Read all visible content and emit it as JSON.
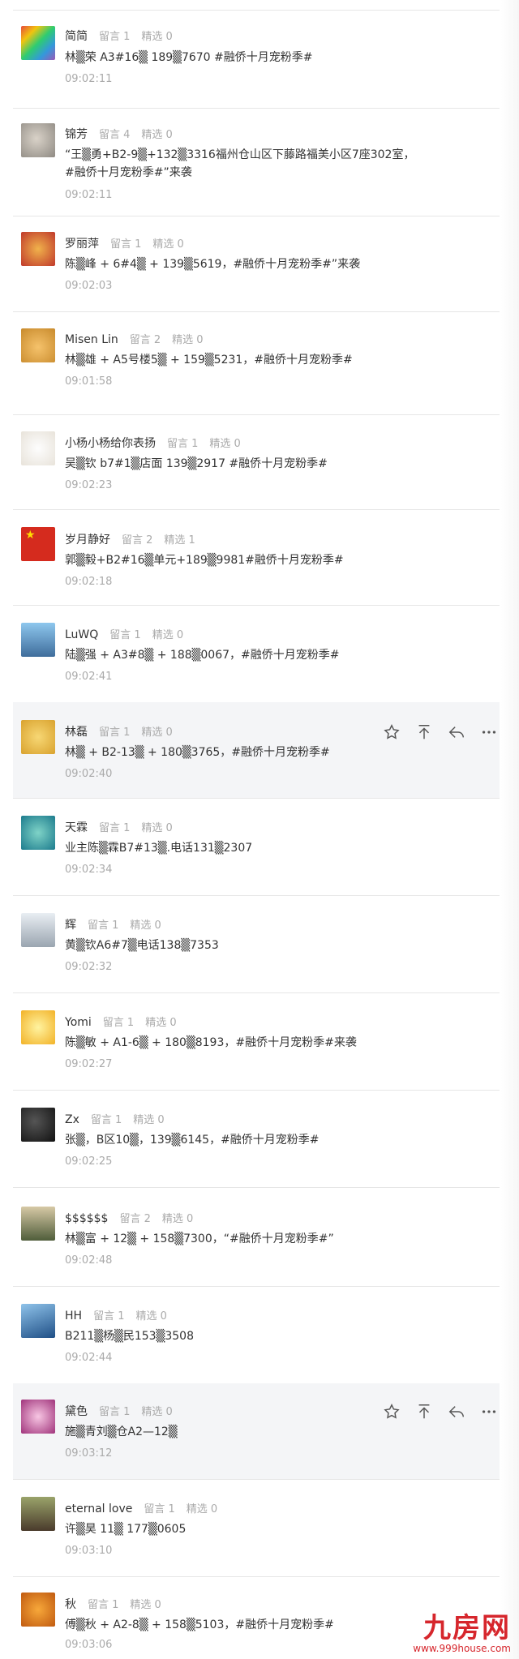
{
  "watermark": {
    "logo": "九房网",
    "url": "www.999house.com"
  },
  "comments": [
    {
      "nick": "简简",
      "msg": "留言 1",
      "sel": "精选 0",
      "content": "林▒荣 A3#16▒ 189▒7670 #融侨十月宠粉季#",
      "time": "09:02:11",
      "highlight": false
    },
    {
      "nick": "锦芳",
      "msg": "留言 4",
      "sel": "精选 0",
      "content": "“王▒勇+B2-9▒+132▒3316福州仓山区下藤路福美小区7座302室，#融侨十月宠粉季#”来袭",
      "time": "09:02:11",
      "highlight": false
    },
    {
      "nick": "罗丽萍",
      "msg": "留言 1",
      "sel": "精选 0",
      "content": "陈▒峰 + 6#4▒ + 139▒5619，#融侨十月宠粉季#”来袭",
      "time": "09:02:03",
      "highlight": false
    },
    {
      "nick": "Misen Lin",
      "msg": "留言 2",
      "sel": "精选 0",
      "content": "林▒雄 + A5号楼5▒ + 159▒5231，#融侨十月宠粉季#",
      "time": "09:01:58",
      "highlight": false
    },
    {
      "nick": "小杨小杨给你表扬",
      "msg": "留言 1",
      "sel": "精选 0",
      "content": "吴▒钦 b7#1▒店面 139▒2917 #融侨十月宠粉季#",
      "time": "09:02:23",
      "highlight": false
    },
    {
      "nick": "岁月静好",
      "msg": "留言 2",
      "sel": "精选 1",
      "content": "郭▒毅+B2#16▒单元+189▒9981#融侨十月宠粉季#",
      "time": "09:02:18",
      "highlight": false
    },
    {
      "nick": "LuWQ",
      "msg": "留言 1",
      "sel": "精选 0",
      "content": "陆▒强 + A3#8▒ + 188▒0067，#融侨十月宠粉季#",
      "time": "09:02:41",
      "highlight": false
    },
    {
      "nick": "林磊",
      "msg": "留言 1",
      "sel": "精选 0",
      "content": "林▒ + B2-13▒ + 180▒3765，#融侨十月宠粉季#",
      "time": "09:02:40",
      "highlight": true
    },
    {
      "nick": "天霖",
      "msg": "留言 1",
      "sel": "精选 0",
      "content": "业主陈▒霖B7#13▒.电话131▒2307",
      "time": "09:02:34",
      "highlight": false
    },
    {
      "nick": "辉",
      "msg": "留言 1",
      "sel": "精选 0",
      "content": "黄▒钦A6#7▒电话138▒7353",
      "time": "09:02:32",
      "highlight": false
    },
    {
      "nick": "Yomi",
      "msg": "留言 1",
      "sel": "精选 0",
      "content": "陈▒敏 + A1-6▒ + 180▒8193，#融侨十月宠粉季#来袭",
      "time": "09:02:27",
      "highlight": false
    },
    {
      "nick": "Zx",
      "msg": "留言 1",
      "sel": "精选 0",
      "content": "张▒，B区10▒，139▒6145，#融侨十月宠粉季#",
      "time": "09:02:25",
      "highlight": false
    },
    {
      "nick": "$$$$$$",
      "msg": "留言 2",
      "sel": "精选 0",
      "content": "林▒富 + 12▒ + 158▒7300，“#融侨十月宠粉季#”",
      "time": "09:02:48",
      "highlight": false
    },
    {
      "nick": "HH",
      "msg": "留言 1",
      "sel": "精选 0",
      "content": "B211▒杨▒民153▒3508",
      "time": "09:02:44",
      "highlight": false
    },
    {
      "nick": "黛色",
      "msg": "留言 1",
      "sel": "精选 0",
      "content": "施▒青刘▒仓A2—12▒",
      "time": "09:03:12",
      "highlight": true
    },
    {
      "nick": "eternal love",
      "msg": "留言 1",
      "sel": "精选 0",
      "content": "许▒昊 11▒ 177▒0605",
      "time": "09:03:10",
      "highlight": false
    },
    {
      "nick": "秋",
      "msg": "留言 1",
      "sel": "精选 0",
      "content": "傅▒秋 + A2-8▒ + 158▒5103，#融侨十月宠粉季#",
      "time": "09:03:06",
      "highlight": false
    }
  ]
}
